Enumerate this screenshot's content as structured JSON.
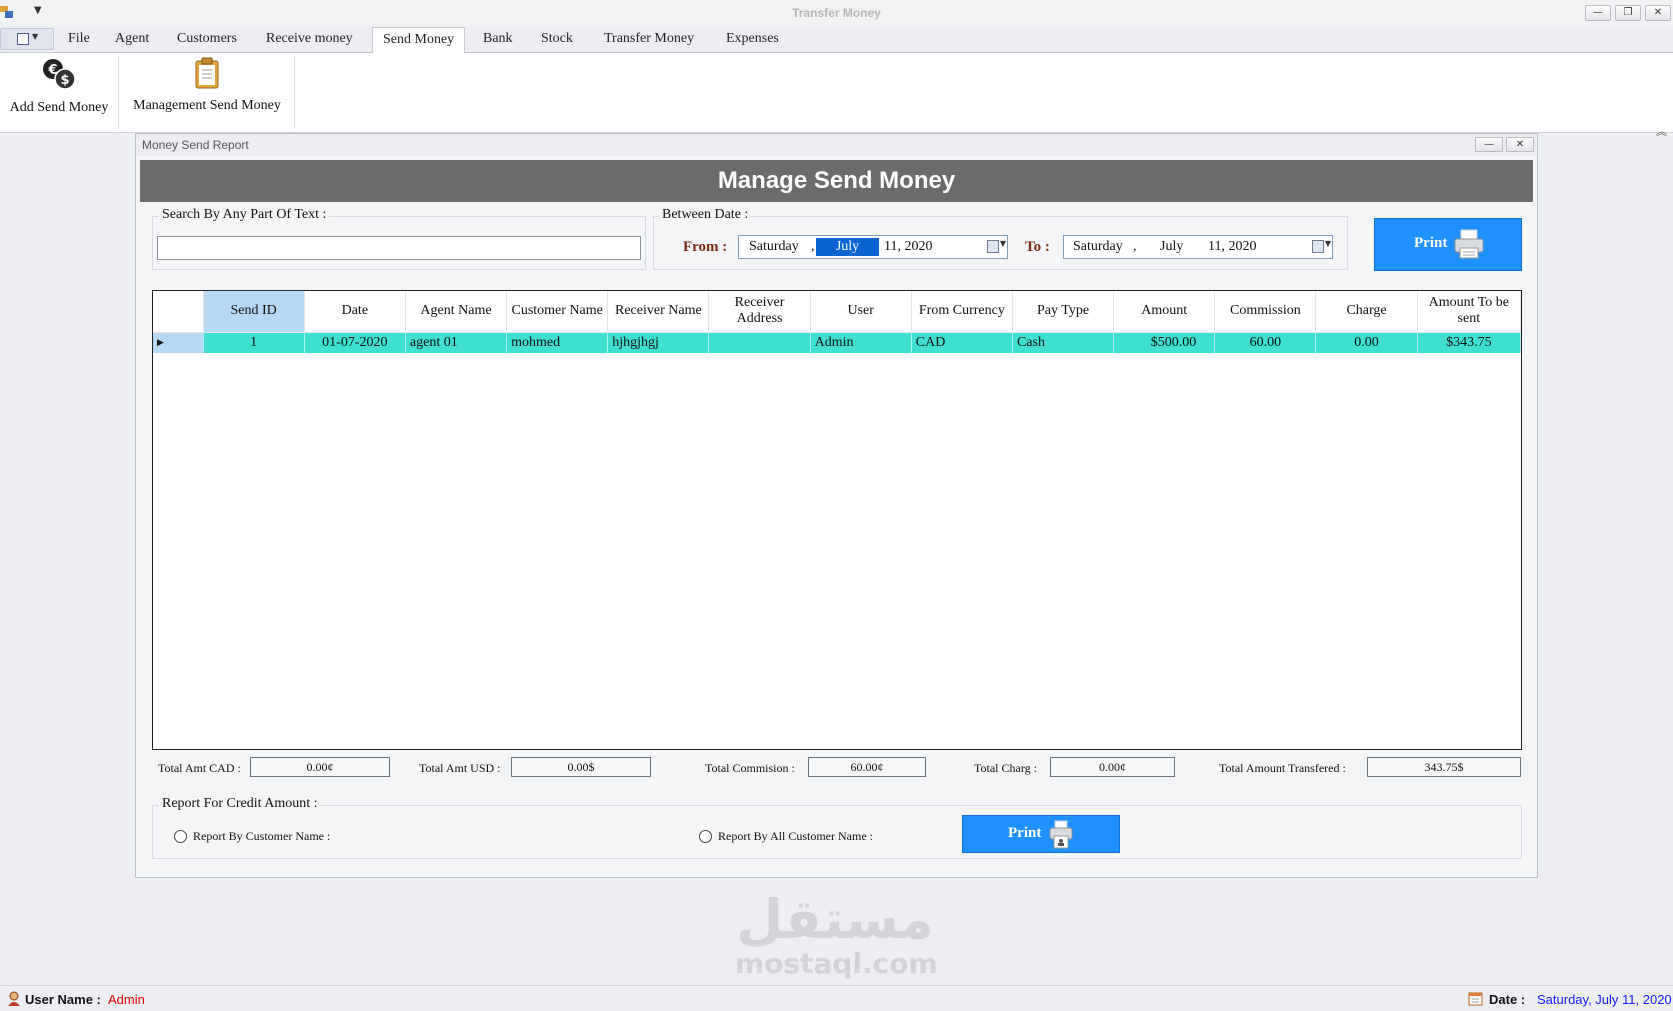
{
  "window": {
    "title": "Transfer Money"
  },
  "ribbon": {
    "tabs": [
      "File",
      "Agent",
      "Customers",
      "Receive money",
      "Send Money",
      "Bank",
      "Stock",
      "Transfer Money",
      "Expenses"
    ],
    "active_tab": "Send Money",
    "buttons": {
      "add_send_money": "Add Send Money",
      "management_send_money": "Management Send Money"
    }
  },
  "child_window": {
    "title": "Money Send Report"
  },
  "banner": "Manage Send Money",
  "search": {
    "group_title": "Search By Any Part Of Text :",
    "value": ""
  },
  "date_filter": {
    "group_title": "Between Date :",
    "from_label": "From :",
    "to_label": "To :",
    "from": {
      "weekday": "Saturday",
      "sep": ",",
      "month": "July",
      "day_year": "11, 2020"
    },
    "to": {
      "weekday": "Saturday",
      "sep": ",",
      "month": "July",
      "day_year": "11, 2020"
    }
  },
  "print_button": "Print",
  "grid": {
    "columns": [
      "Send ID",
      "Date",
      "Agent Name",
      "Customer Name",
      "Receiver Name",
      "Receiver Address",
      "User",
      "From Currency",
      "Pay Type",
      "Amount",
      "Commission",
      "Charge",
      "Amount To be sent"
    ],
    "rows": [
      {
        "send_id": "1",
        "date": "01-07-2020",
        "agent_name": "agent 01",
        "customer_name": "mohmed",
        "receiver_name": "hjhgjhgj",
        "receiver_address": "",
        "user": "Admin",
        "from_currency": "CAD",
        "pay_type": "Cash",
        "amount": "$500.00",
        "commission": "60.00",
        "charge": "0.00",
        "amount_to_send": "$343.75"
      }
    ]
  },
  "totals": {
    "cad_label": "Total Amt CAD :",
    "cad_value": "0.00¢",
    "usd_label": "Total Amt USD :",
    "usd_value": "0.00$",
    "commission_label": "Total Commision :",
    "commission_value": "60.00¢",
    "charge_label": "Total Charg :",
    "charge_value": "0.00¢",
    "transferred_label": "Total Amount Transfered :",
    "transferred_value": "343.75$"
  },
  "credit_report": {
    "group_title": "Report For Credit Amount :",
    "option_customer": "Report By Customer Name :",
    "option_all": "Report By All Customer Name :",
    "print": "Print"
  },
  "statusbar": {
    "user_label": "User Name :",
    "user_value": "Admin",
    "date_label": "Date :",
    "date_value": "Saturday, July 11, 2020"
  },
  "watermark": {
    "arabic": "مستقل",
    "latin": "mostaql.com"
  },
  "colors": {
    "row_highlight": "#40e0d0",
    "print_button": "#1e90ff",
    "banner": "#6b6b6b",
    "date_selection": "#0a64d2",
    "user_value": "#e00000",
    "date_value": "#1a1aff"
  }
}
